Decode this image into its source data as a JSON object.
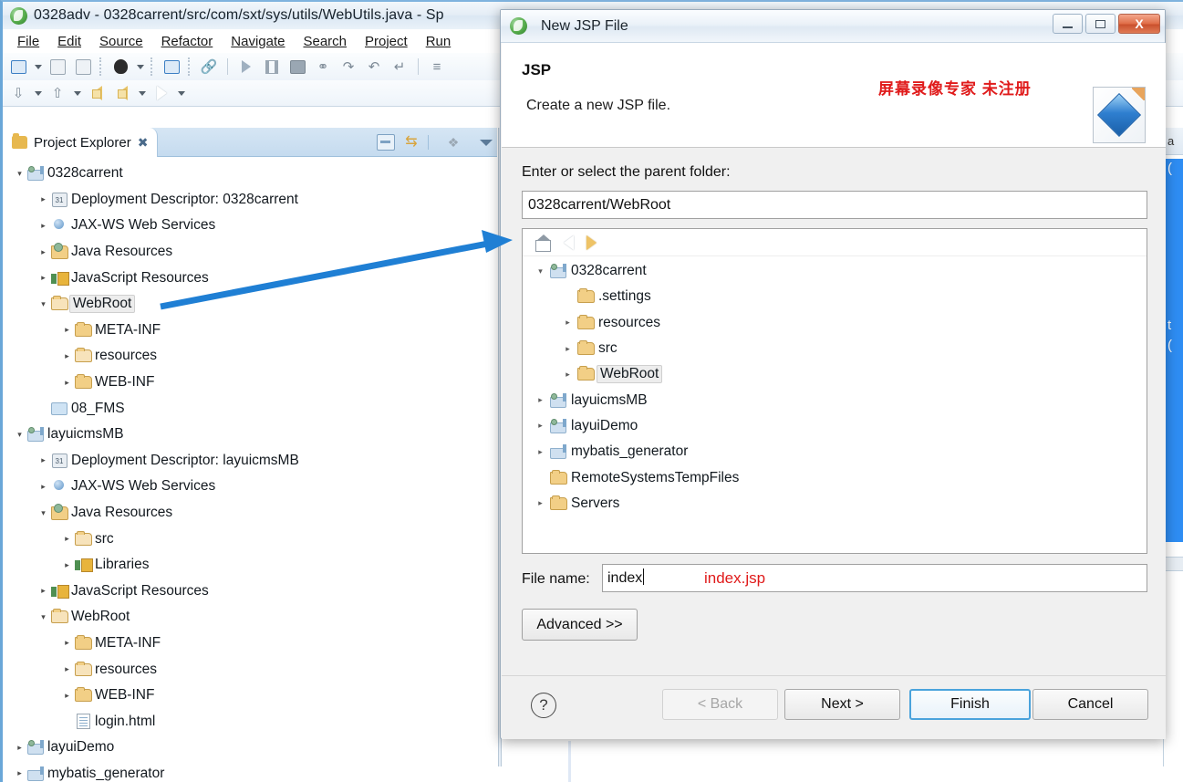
{
  "ide": {
    "title": "0328adv - 0328carrent/src/com/sxt/sys/utils/WebUtils.java - Sp",
    "logo_icon": "eclipse-logo-icon",
    "menu": [
      {
        "label": "File"
      },
      {
        "label": "Edit"
      },
      {
        "label": "Source"
      },
      {
        "label": "Refactor"
      },
      {
        "label": "Navigate"
      },
      {
        "label": "Search"
      },
      {
        "label": "Project"
      },
      {
        "label": "Run"
      }
    ],
    "toolbar_icons": [
      "new-file-icon",
      "dropdown-arrow-icon",
      "save-icon",
      "save-all-icon",
      "person-icon",
      "dropdown-arrow-icon",
      "console-icon",
      "link-break-icon",
      "run-icon",
      "pause-icon",
      "stop-icon",
      "graph-icon",
      "step-over-icon",
      "step-return-icon",
      "step-into-icon",
      "menu-list-icon"
    ],
    "toolbar_icons_row2": [
      "download-icon",
      "dropdown-arrow-icon",
      "upload-icon",
      "dropdown-arrow-icon",
      "back-arrow-icon",
      "forward-back-arrow-icon",
      "dropdown-arrow-icon",
      "forward-arrow-icon",
      "dropdown-arrow-icon"
    ]
  },
  "project_explorer": {
    "tab_label": "Project Explorer",
    "tab_close": "✖",
    "toolbar": [
      "collapse-all-icon",
      "link-with-editor-icon",
      "view-menu-icon",
      "chevron-down-icon"
    ],
    "tree": [
      {
        "indent": 0,
        "twisty": "▾",
        "icon": "project-icon",
        "label": "0328carrent",
        "selected": false
      },
      {
        "indent": 1,
        "twisty": "▸",
        "icon": "deployment-descriptor-icon",
        "label": "Deployment Descriptor: 0328carrent",
        "selected": false
      },
      {
        "indent": 1,
        "twisty": "▸",
        "icon": "web-service-icon",
        "label": "JAX-WS Web Services",
        "selected": false
      },
      {
        "indent": 1,
        "twisty": "▸",
        "icon": "java-resources-icon",
        "label": "Java Resources",
        "selected": false
      },
      {
        "indent": 1,
        "twisty": "▸",
        "icon": "library-icon",
        "label": "JavaScript Resources",
        "selected": false
      },
      {
        "indent": 1,
        "twisty": "▾",
        "icon": "folder-res-icon",
        "label": "WebRoot",
        "selected": true
      },
      {
        "indent": 2,
        "twisty": "▸",
        "icon": "folder-icon",
        "label": "META-INF",
        "selected": false
      },
      {
        "indent": 2,
        "twisty": "▸",
        "icon": "folder-res-icon",
        "label": "resources",
        "selected": false
      },
      {
        "indent": 2,
        "twisty": "▸",
        "icon": "folder-icon",
        "label": "WEB-INF",
        "selected": false
      },
      {
        "indent": 1,
        "twisty": "",
        "icon": "tray-icon",
        "label": "08_FMS",
        "selected": false
      },
      {
        "indent": 0,
        "twisty": "▾",
        "icon": "project-icon",
        "label": "layuicmsMB",
        "selected": false
      },
      {
        "indent": 1,
        "twisty": "▸",
        "icon": "deployment-descriptor-icon",
        "label": "Deployment Descriptor: layuicmsMB",
        "selected": false
      },
      {
        "indent": 1,
        "twisty": "▸",
        "icon": "web-service-icon",
        "label": "JAX-WS Web Services",
        "selected": false
      },
      {
        "indent": 1,
        "twisty": "▾",
        "icon": "java-resources-icon",
        "label": "Java Resources",
        "selected": false
      },
      {
        "indent": 2,
        "twisty": "▸",
        "icon": "source-folder-icon",
        "label": "src",
        "selected": false
      },
      {
        "indent": 2,
        "twisty": "▸",
        "icon": "library-icon",
        "label": "Libraries",
        "selected": false
      },
      {
        "indent": 1,
        "twisty": "▸",
        "icon": "library-icon",
        "label": "JavaScript Resources",
        "selected": false
      },
      {
        "indent": 1,
        "twisty": "▾",
        "icon": "folder-res-icon",
        "label": "WebRoot",
        "selected": false
      },
      {
        "indent": 2,
        "twisty": "▸",
        "icon": "folder-icon",
        "label": "META-INF",
        "selected": false
      },
      {
        "indent": 2,
        "twisty": "▸",
        "icon": "folder-res-icon",
        "label": "resources",
        "selected": false
      },
      {
        "indent": 2,
        "twisty": "▸",
        "icon": "folder-icon",
        "label": "WEB-INF",
        "selected": false
      },
      {
        "indent": 2,
        "twisty": "",
        "icon": "html-file-icon",
        "label": "login.html",
        "selected": false
      },
      {
        "indent": 0,
        "twisty": "▸",
        "icon": "project-icon",
        "label": "layuiDemo",
        "selected": false
      },
      {
        "indent": 0,
        "twisty": "▸",
        "icon": "project-plain-icon",
        "label": "mybatis_generator",
        "selected": false
      }
    ]
  },
  "editor_sliver": {
    "tab_label": "a",
    "line1": "(",
    "line2": "t",
    "line3": "("
  },
  "dialog": {
    "title": "New JSP File",
    "title_icon": "eclipse-logo-icon",
    "window_buttons": {
      "minimize": "minimize-icon",
      "maximize": "maximize-icon",
      "close": "X"
    },
    "header_title": "JSP",
    "header_desc": "Create a new JSP file.",
    "header_icon": "jsp-file-icon",
    "watermark": "屏幕录像专家  未注册",
    "parent_label": "Enter or select the parent folder:",
    "parent_value": "0328carrent/WebRoot",
    "tree_toolbar": [
      "home-icon",
      "back-arrow-icon",
      "forward-arrow-icon"
    ],
    "tree": [
      {
        "indent": 0,
        "twisty": "▾",
        "icon": "project-icon",
        "label": "0328carrent",
        "selected": false
      },
      {
        "indent": 1,
        "twisty": "",
        "icon": "folder-icon",
        "label": ".settings",
        "selected": false
      },
      {
        "indent": 1,
        "twisty": "▸",
        "icon": "folder-icon",
        "label": "resources",
        "selected": false
      },
      {
        "indent": 1,
        "twisty": "▸",
        "icon": "folder-icon",
        "label": "src",
        "selected": false
      },
      {
        "indent": 1,
        "twisty": "▸",
        "icon": "folder-icon",
        "label": "WebRoot",
        "selected": true
      },
      {
        "indent": 0,
        "twisty": "▸",
        "icon": "project-icon",
        "label": "layuicmsMB",
        "selected": false
      },
      {
        "indent": 0,
        "twisty": "▸",
        "icon": "project-icon",
        "label": "layuiDemo",
        "selected": false
      },
      {
        "indent": 0,
        "twisty": "▸",
        "icon": "project-plain-icon",
        "label": "mybatis_generator",
        "selected": false
      },
      {
        "indent": 0,
        "twisty": "",
        "icon": "folder-icon",
        "label": "RemoteSystemsTempFiles",
        "selected": false
      },
      {
        "indent": 0,
        "twisty": "▸",
        "icon": "folder-icon",
        "label": "Servers",
        "selected": false
      }
    ],
    "file_name_label": "File name:",
    "file_name_value": "index",
    "file_name_annotation": "index.jsp",
    "advanced_label": "Advanced >>",
    "help_label": "?",
    "buttons": {
      "back": "< Back",
      "next": "Next >",
      "finish": "Finish",
      "cancel": "Cancel"
    }
  },
  "annotation": {
    "arrow_color": "#1f7fd4",
    "accent_color": "#e01b1b"
  }
}
